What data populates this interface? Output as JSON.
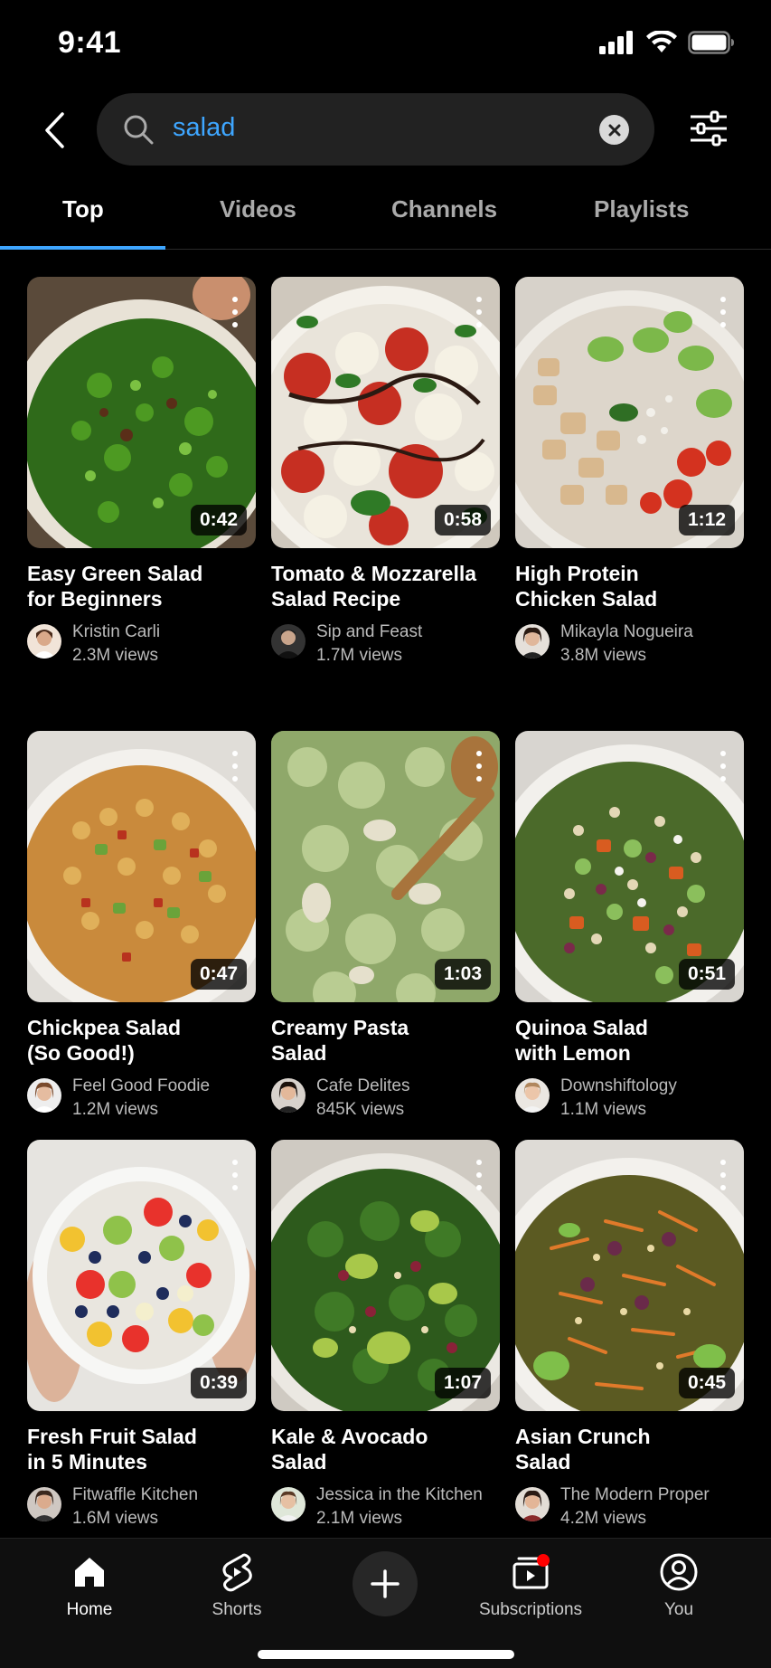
{
  "status": {
    "time": "9:41"
  },
  "search": {
    "query": "salad"
  },
  "tabs": [
    {
      "label": "Top",
      "active": true
    },
    {
      "label": "Videos",
      "active": false
    },
    {
      "label": "Channels",
      "active": false
    },
    {
      "label": "Playlists",
      "active": false
    }
  ],
  "videos": [
    {
      "title": "Easy Green Salad\nfor Beginners",
      "channel": "Kristin Carli",
      "views": "2.3M views",
      "duration": "0:42"
    },
    {
      "title": "Tomato & Mozzarella\nSalad Recipe",
      "channel": "Sip and Feast",
      "views": "1.7M views",
      "duration": "0:58"
    },
    {
      "title": "High Protein\nChicken Salad",
      "channel": "Mikayla Nogueira",
      "views": "3.8M views",
      "duration": "1:12"
    },
    {
      "title": "Chickpea Salad\n(So Good!)",
      "channel": "Feel Good Foodie",
      "views": "1.2M views",
      "duration": "0:47"
    },
    {
      "title": "Creamy Pasta\nSalad",
      "channel": "Cafe Delites",
      "views": "845K views",
      "duration": "1:03"
    },
    {
      "title": "Quinoa Salad\nwith Lemon",
      "channel": "Downshiftology",
      "views": "1.1M views",
      "duration": "0:51"
    },
    {
      "title": "Fresh Fruit Salad\nin 5 Minutes",
      "channel": "Fitwaffle Kitchen",
      "views": "1.6M views",
      "duration": "0:39"
    },
    {
      "title": "Kale & Avocado\nSalad",
      "channel": "Jessica in the Kitchen",
      "views": "2.1M views",
      "duration": "1:07"
    },
    {
      "title": "Asian Crunch\nSalad",
      "channel": "The Modern Proper",
      "views": "4.2M views",
      "duration": "0:45"
    }
  ],
  "nav": {
    "home": "Home",
    "shorts": "Shorts",
    "subscriptions": "Subscriptions",
    "you": "You"
  },
  "colors": {
    "accent": "#3ea6ff",
    "notification": "#ff0000"
  }
}
